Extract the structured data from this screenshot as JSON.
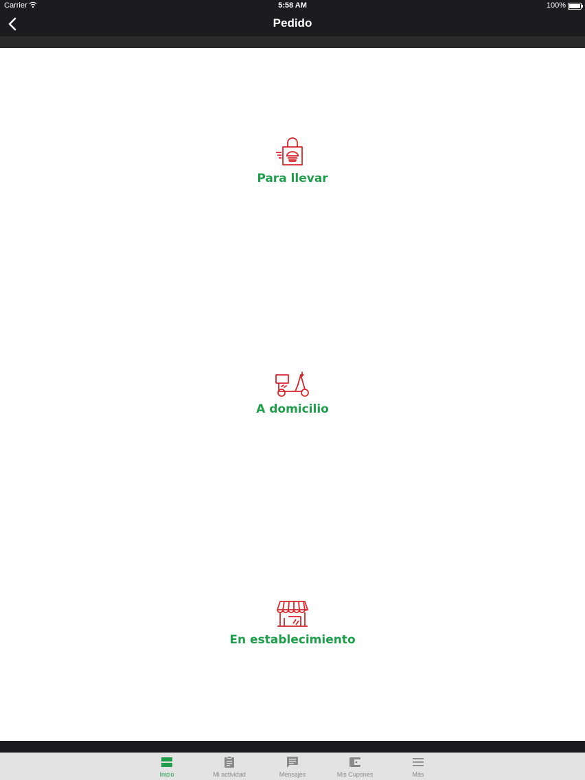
{
  "status_bar": {
    "carrier": "Carrier",
    "time": "5:58 AM",
    "battery": "100%"
  },
  "nav": {
    "title": "Pedido",
    "back_icon": "chevron-left-icon"
  },
  "options": [
    {
      "label": "Para llevar",
      "icon": "takeaway-bag-icon"
    },
    {
      "label": "A domicilio",
      "icon": "delivery-scooter-icon"
    },
    {
      "label": "En establecimiento",
      "icon": "storefront-icon"
    }
  ],
  "tabs": [
    {
      "label": "Inicio",
      "icon": "home-icon",
      "active": true
    },
    {
      "label": "Mi actividad",
      "icon": "clipboard-icon",
      "active": false
    },
    {
      "label": "Mensajes",
      "icon": "message-icon",
      "active": false
    },
    {
      "label": "Mis Cupones",
      "icon": "wallet-icon",
      "active": false
    },
    {
      "label": "Más",
      "icon": "menu-icon",
      "active": false
    }
  ],
  "colors": {
    "accent_green": "#1e9e4a",
    "icon_red": "#d8262c",
    "bar_dark": "#1c1c1e",
    "tab_bg": "#e3e3e3",
    "tab_inactive": "#8a8a8a"
  }
}
